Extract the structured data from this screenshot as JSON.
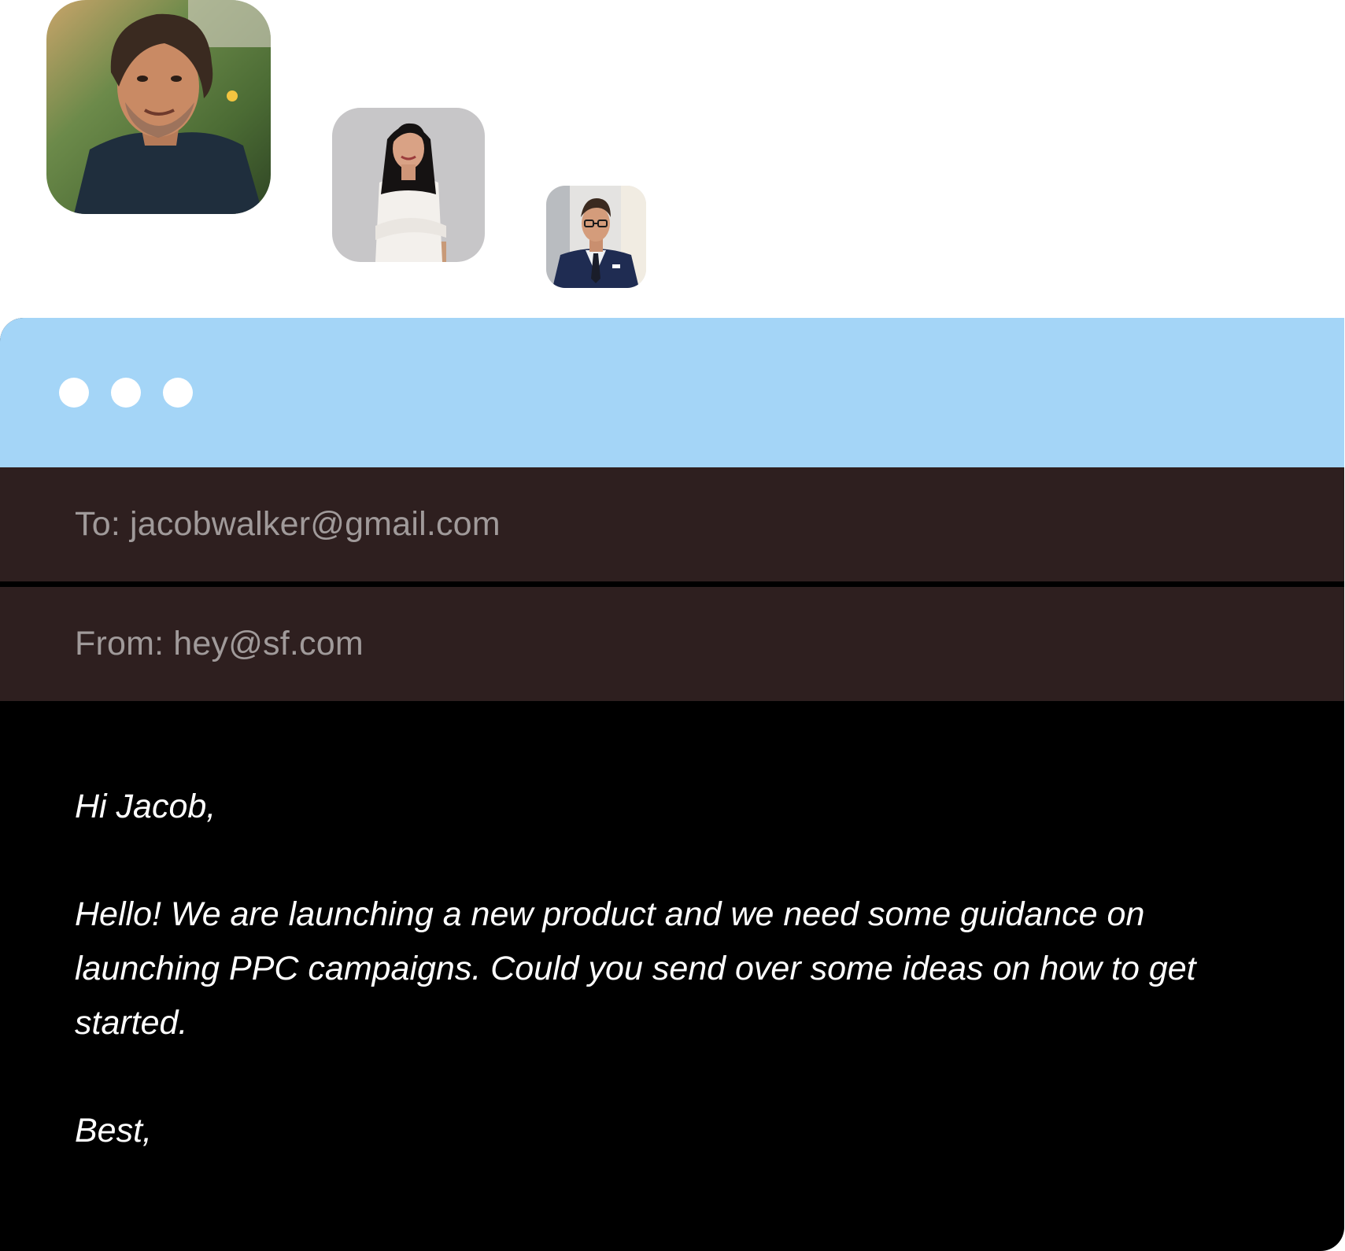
{
  "avatars": [
    {
      "name": "avatar-man-curly-hair"
    },
    {
      "name": "avatar-woman-white-top"
    },
    {
      "name": "avatar-man-suit-glasses"
    }
  ],
  "window": {
    "titlebar_color": "#a4d5f7",
    "dots": [
      "window-dot-1",
      "window-dot-2",
      "window-dot-3"
    ]
  },
  "email": {
    "to_label": "To:",
    "to_value": "jacobwalker@gmail.com",
    "from_label": "From:",
    "from_value": "hey@sf.com",
    "greeting": "Hi Jacob,",
    "message": "Hello! We are launching a new product and we need some guidance on launching PPC campaigns. Could you send over some ideas on how to get started.",
    "signoff": "Best,"
  },
  "colors": {
    "header_row_bg": "#2e1f1f",
    "body_bg": "#000000",
    "field_text": "#a09a9a",
    "body_text": "#ffffff"
  }
}
